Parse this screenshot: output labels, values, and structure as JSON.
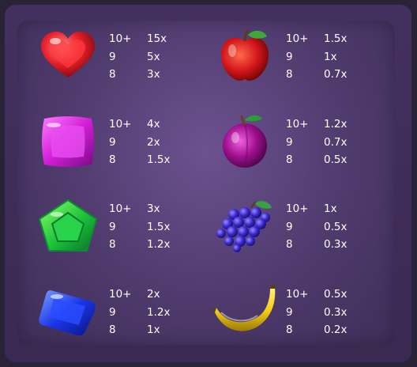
{
  "paytable": [
    {
      "symbol": "heart-candy",
      "rows": [
        {
          "count": "10+",
          "mult": "15x"
        },
        {
          "count": "9",
          "mult": "5x"
        },
        {
          "count": "8",
          "mult": "3x"
        }
      ]
    },
    {
      "symbol": "apple",
      "rows": [
        {
          "count": "10+",
          "mult": "1.5x"
        },
        {
          "count": "9",
          "mult": "1x"
        },
        {
          "count": "8",
          "mult": "0.7x"
        }
      ]
    },
    {
      "symbol": "purple-square-candy",
      "rows": [
        {
          "count": "10+",
          "mult": "4x"
        },
        {
          "count": "9",
          "mult": "2x"
        },
        {
          "count": "8",
          "mult": "1.5x"
        }
      ]
    },
    {
      "symbol": "plum",
      "rows": [
        {
          "count": "10+",
          "mult": "1.2x"
        },
        {
          "count": "9",
          "mult": "0.7x"
        },
        {
          "count": "8",
          "mult": "0.5x"
        }
      ]
    },
    {
      "symbol": "green-pentagon-candy",
      "rows": [
        {
          "count": "10+",
          "mult": "3x"
        },
        {
          "count": "9",
          "mult": "1.5x"
        },
        {
          "count": "8",
          "mult": "1.2x"
        }
      ]
    },
    {
      "symbol": "grapes",
      "rows": [
        {
          "count": "10+",
          "mult": "1x"
        },
        {
          "count": "9",
          "mult": "0.5x"
        },
        {
          "count": "8",
          "mult": "0.3x"
        }
      ]
    },
    {
      "symbol": "blue-gem-candy",
      "rows": [
        {
          "count": "10+",
          "mult": "2x"
        },
        {
          "count": "9",
          "mult": "1.2x"
        },
        {
          "count": "8",
          "mult": "1x"
        }
      ]
    },
    {
      "symbol": "banana",
      "rows": [
        {
          "count": "10+",
          "mult": "0.5x"
        },
        {
          "count": "9",
          "mult": "0.3x"
        },
        {
          "count": "8",
          "mult": "0.2x"
        }
      ]
    }
  ]
}
